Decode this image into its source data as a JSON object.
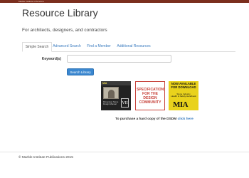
{
  "topbar": {
    "label": "Marble Institute of America"
  },
  "header": {
    "title": "Resource Library",
    "subtitle": "For architects, designers, and contractors"
  },
  "tabs": [
    {
      "label": "Simple Search",
      "active": true
    },
    {
      "label": "Advanced Search",
      "active": false
    },
    {
      "label": "Find a Member",
      "active": false
    },
    {
      "label": "Additional Resources",
      "active": false
    }
  ],
  "search": {
    "keyword_label": "Keyword(s)",
    "keyword_value": "",
    "button_label": "Search Library"
  },
  "books": {
    "book1": {
      "logo": "MIA",
      "title_lines": [
        "Dimension Stone",
        "Design Manual"
      ],
      "edition": "VII"
    },
    "book2": {
      "lines": [
        "SPECIFICATIONS",
        "FOR THE",
        "DESIGN",
        "COMMUNITY"
      ]
    },
    "book3": {
      "headline": [
        "NOW AVAILABLE",
        "FOR DOWNLOAD"
      ],
      "sub": [
        "Stone Industry",
        "Health & Safety Handbook"
      ],
      "logo": "MIA"
    }
  },
  "purchase": {
    "text": "To purchase a hard copy of the DSDM",
    "link": "click here"
  },
  "footer": {
    "copyright": "© Marble Institute Publications 2015"
  },
  "colors": {
    "accent": "#3a87d0",
    "link": "#3a7bbf",
    "topbar": "#7b2f1e"
  }
}
